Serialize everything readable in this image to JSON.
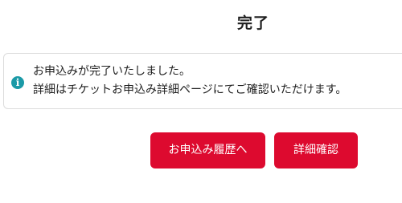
{
  "page": {
    "title": "完了"
  },
  "notice": {
    "icon": "info-icon",
    "icon_glyph": "i",
    "line1": "お申込みが完了いたしました。",
    "line2": "詳細はチケットお申込み詳細ページにてご確認いただけます。"
  },
  "actions": {
    "history_label": "お申込み履歴へ",
    "detail_label": "詳細確認"
  },
  "colors": {
    "button": "#dd0a2f",
    "info_icon": "#1b9aa7"
  }
}
